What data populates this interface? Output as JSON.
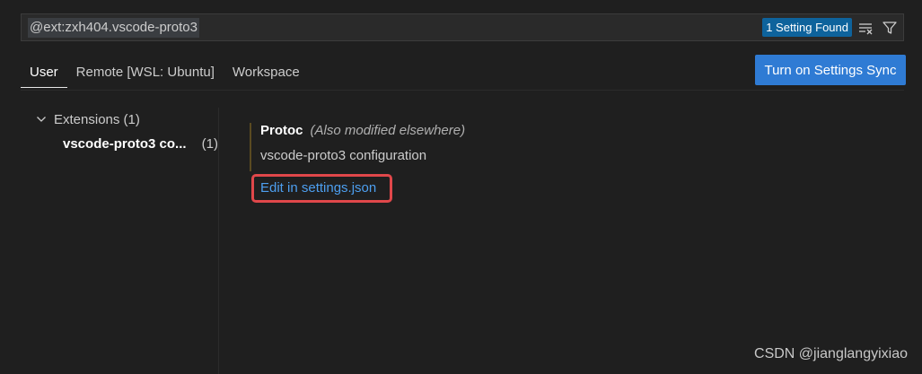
{
  "search": {
    "value": "@ext:zxh404.vscode-proto3",
    "result_count": "1 Setting Found"
  },
  "icons": {
    "clear_filter": "clear-filter-icon",
    "filter": "filter-icon",
    "chevron": "chevron-down-icon"
  },
  "tabs": [
    {
      "label": "User",
      "active": true
    },
    {
      "label": "Remote [WSL: Ubuntu]",
      "active": false
    },
    {
      "label": "Workspace",
      "active": false
    }
  ],
  "sync_button": {
    "label": "Turn on Settings Sync"
  },
  "toc": {
    "group_label": "Extensions (1)",
    "item_label": "vscode-proto3 co...",
    "item_count": "(1)"
  },
  "setting": {
    "name": "Protoc",
    "note": "(Also modified elsewhere)",
    "description": "vscode-proto3 configuration",
    "edit_link": "Edit in settings.json"
  },
  "watermark": "CSDN @jianglangyixiao",
  "colors": {
    "background": "#1f1f1f",
    "accent": "#2f7bd4",
    "link": "#4d9ff0",
    "highlight_box": "#e0474a"
  }
}
